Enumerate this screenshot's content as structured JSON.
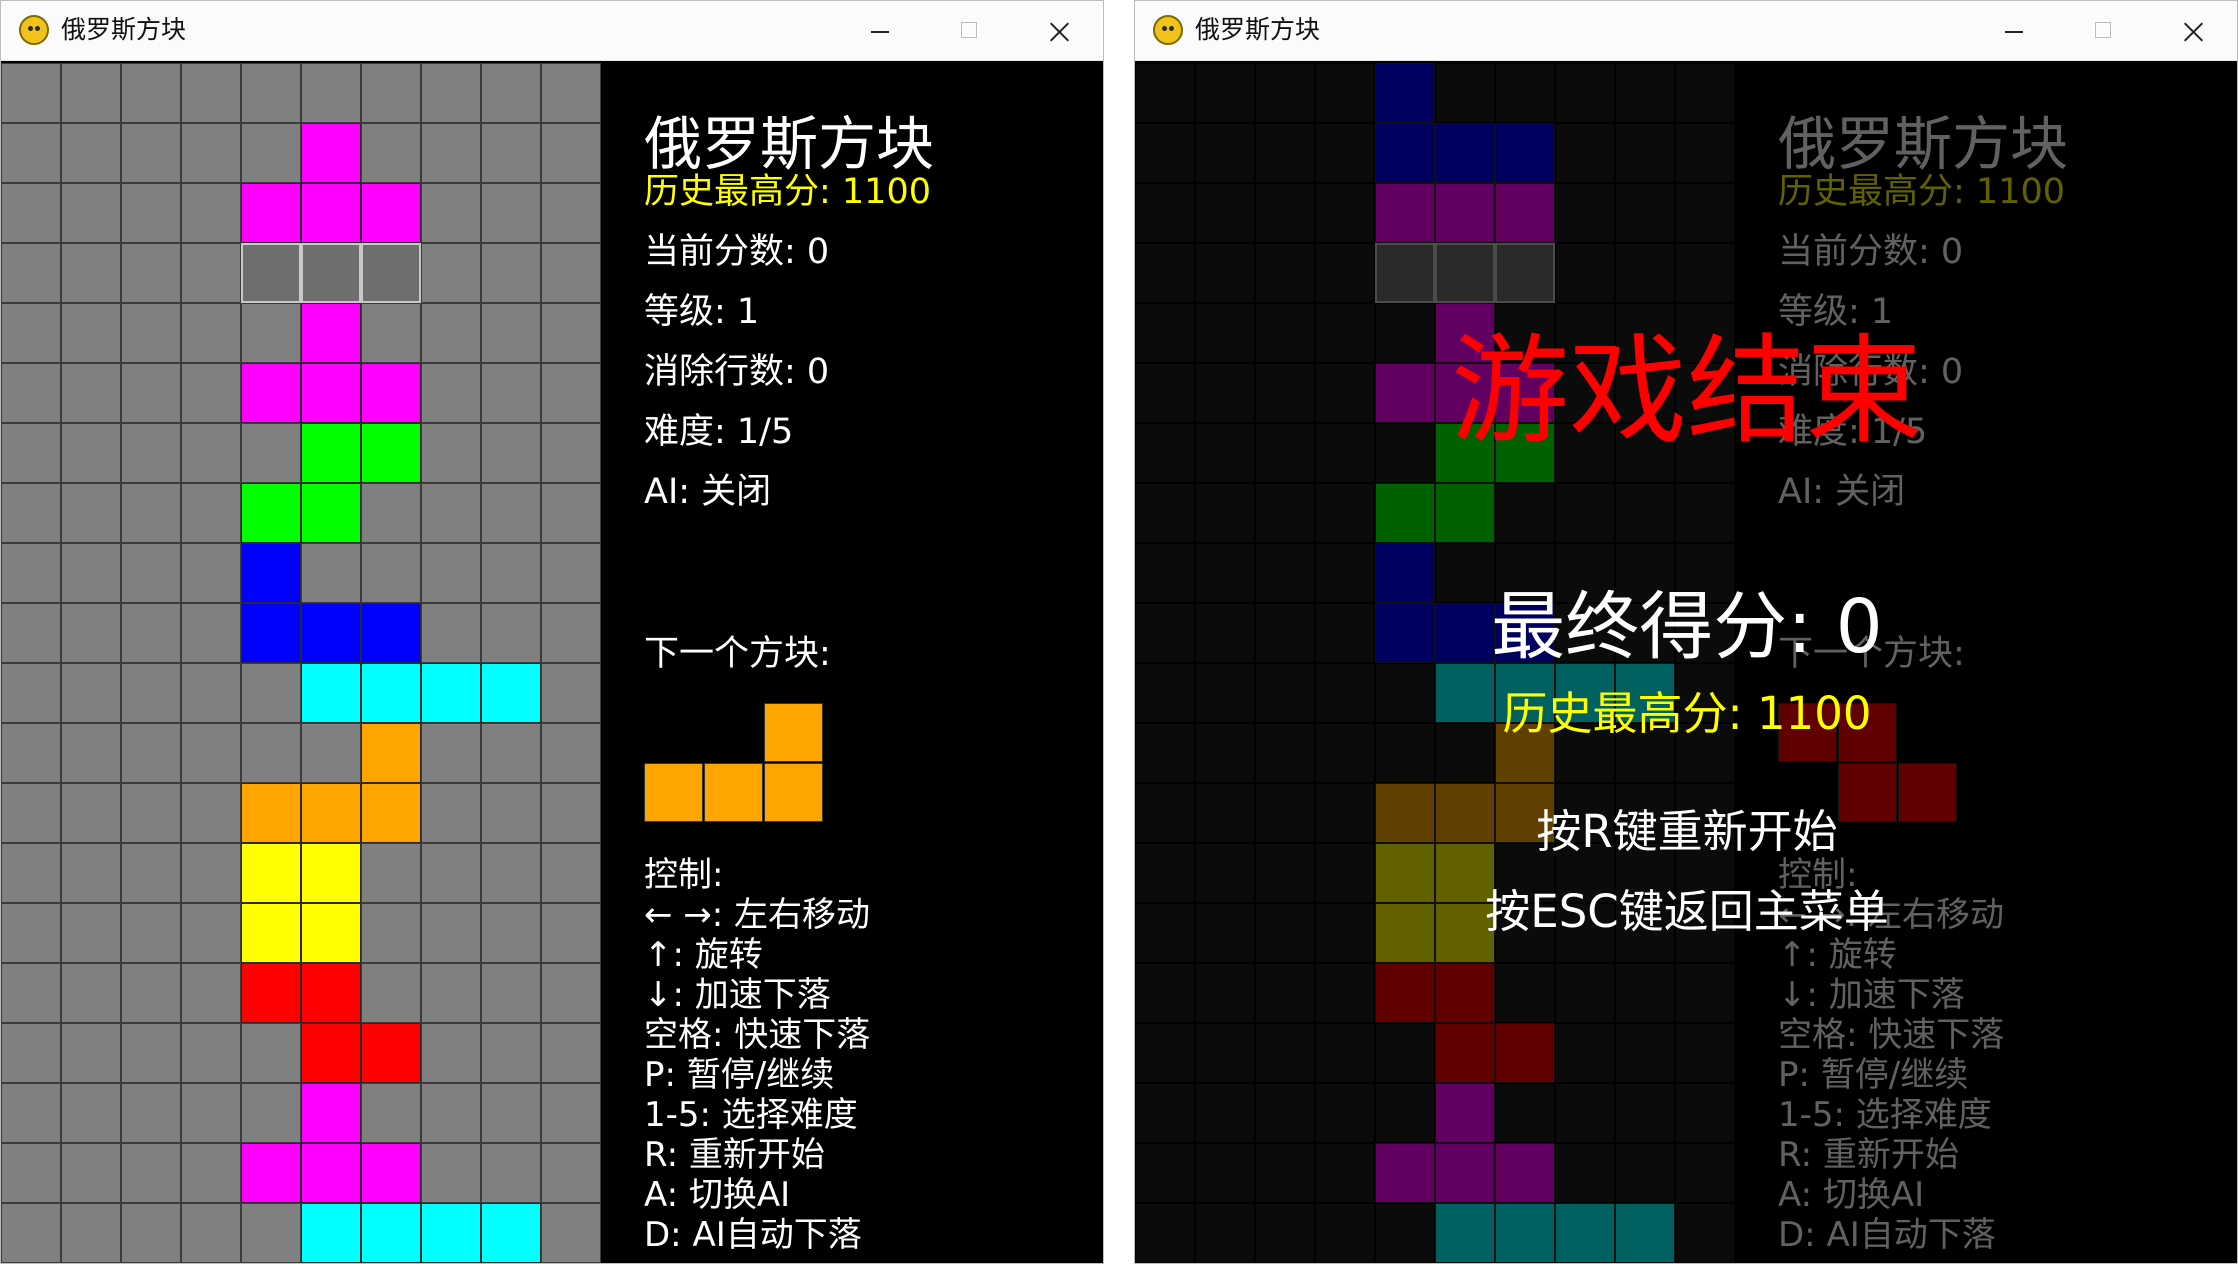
{
  "left_window": {
    "title": "俄罗斯方块",
    "panel": {
      "title": "俄罗斯方块",
      "high_score": "历史最高分: 1100",
      "current_score": "当前分数: 0",
      "level": "等级: 1",
      "lines": "消除行数: 0",
      "difficulty": "难度: 1/5",
      "ai": "AI: 关闭",
      "next_label": "下一个方块:",
      "controls_title": "控制:",
      "controls": [
        "← →: 左右移动",
        "↑: 旋转",
        "↓: 加速下落",
        "空格: 快速下落",
        "P: 暂停/继续",
        "1-5: 选择难度",
        "R: 重新开始",
        "A: 切换AI",
        "D: AI自动下落"
      ]
    }
  },
  "right_window": {
    "title": "俄罗斯方块",
    "game_over": {
      "title": "游戏结束",
      "final_score": "最终得分: 0",
      "high_score": "历史最高分: 1100",
      "restart_hint": "按R键重新开始",
      "menu_hint": "按ESC键返回主菜单"
    }
  },
  "colors": {
    "magenta": "#ff00ff",
    "green": "#00ff00",
    "blue": "#0000ff",
    "cyan": "#00ffff",
    "orange": "#ffa500",
    "yellow": "#ffff00",
    "red": "#ff0000",
    "ghost": "#6e6e6e"
  },
  "board": {
    "columns": 10,
    "rows": 20,
    "pieces": [
      {
        "color": "magenta",
        "cells": [
          [
            5,
            1
          ],
          [
            4,
            2
          ],
          [
            5,
            2
          ],
          [
            6,
            2
          ]
        ]
      },
      {
        "color": "ghost",
        "cells": [
          [
            4,
            3
          ],
          [
            5,
            3
          ],
          [
            6,
            3
          ]
        ]
      },
      {
        "color": "magenta",
        "cells": [
          [
            5,
            4
          ],
          [
            4,
            5
          ],
          [
            5,
            5
          ],
          [
            6,
            5
          ]
        ]
      },
      {
        "color": "green",
        "cells": [
          [
            5,
            6
          ],
          [
            6,
            6
          ],
          [
            4,
            7
          ],
          [
            5,
            7
          ]
        ]
      },
      {
        "color": "blue",
        "cells": [
          [
            4,
            8
          ],
          [
            4,
            9
          ],
          [
            5,
            9
          ],
          [
            6,
            9
          ]
        ]
      },
      {
        "color": "cyan",
        "cells": [
          [
            5,
            10
          ],
          [
            6,
            10
          ],
          [
            7,
            10
          ],
          [
            8,
            10
          ]
        ]
      },
      {
        "color": "orange",
        "cells": [
          [
            6,
            11
          ],
          [
            4,
            12
          ],
          [
            5,
            12
          ],
          [
            6,
            12
          ]
        ]
      },
      {
        "color": "yellow",
        "cells": [
          [
            4,
            13
          ],
          [
            5,
            13
          ],
          [
            4,
            14
          ],
          [
            5,
            14
          ]
        ]
      },
      {
        "color": "red",
        "cells": [
          [
            4,
            15
          ],
          [
            5,
            15
          ],
          [
            5,
            16
          ],
          [
            6,
            16
          ]
        ]
      },
      {
        "color": "magenta",
        "cells": [
          [
            5,
            17
          ],
          [
            4,
            18
          ],
          [
            5,
            18
          ],
          [
            6,
            18
          ]
        ]
      },
      {
        "color": "cyan",
        "cells": [
          [
            5,
            19
          ],
          [
            6,
            19
          ],
          [
            7,
            19
          ],
          [
            8,
            19
          ]
        ]
      }
    ],
    "right_top_piece": {
      "color": "blue",
      "cells": [
        [
          4,
          0
        ],
        [
          4,
          1
        ],
        [
          5,
          1
        ],
        [
          6,
          1
        ]
      ]
    }
  },
  "next_piece": {
    "color": "orange",
    "cells": [
      [
        2,
        0
      ],
      [
        0,
        1
      ],
      [
        1,
        1
      ],
      [
        2,
        1
      ]
    ],
    "right_color": "red",
    "right_cells": [
      [
        0,
        0
      ],
      [
        1,
        0
      ],
      [
        1,
        1
      ],
      [
        2,
        1
      ]
    ]
  }
}
